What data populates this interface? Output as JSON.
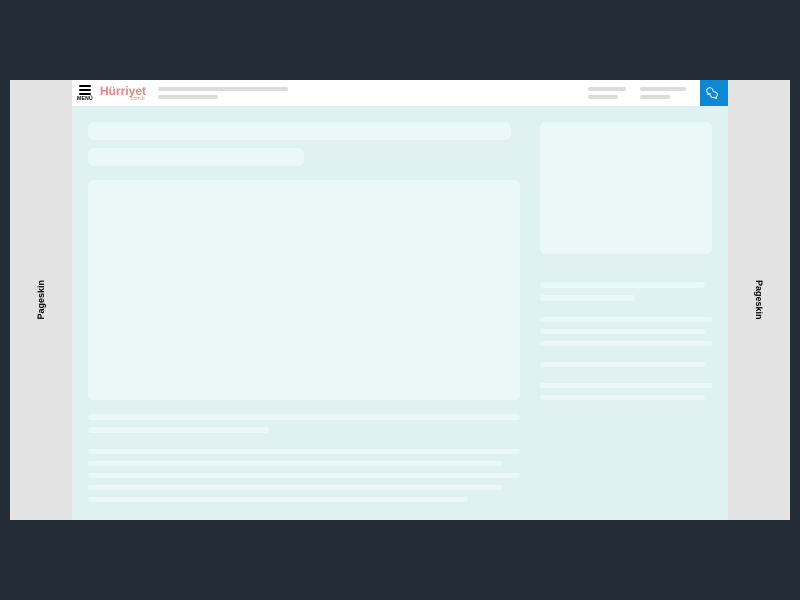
{
  "header": {
    "menu_label": "MENÜ",
    "logo_text": "Hürriyet",
    "logo_sub": ".com.tr"
  },
  "pageskin": {
    "left_label": "Pageskin",
    "right_label": "Pageskin"
  },
  "icons": {
    "hamburger": "hamburger-icon",
    "chat": "chat-icon"
  },
  "colors": {
    "page_bg": "#242c36",
    "skin_bg": "#e3e3e3",
    "content_bg": "#e0f1f1",
    "skeleton": "#eaf8f8",
    "logo": "#f08080",
    "chat_btn": "#0b89d6"
  }
}
